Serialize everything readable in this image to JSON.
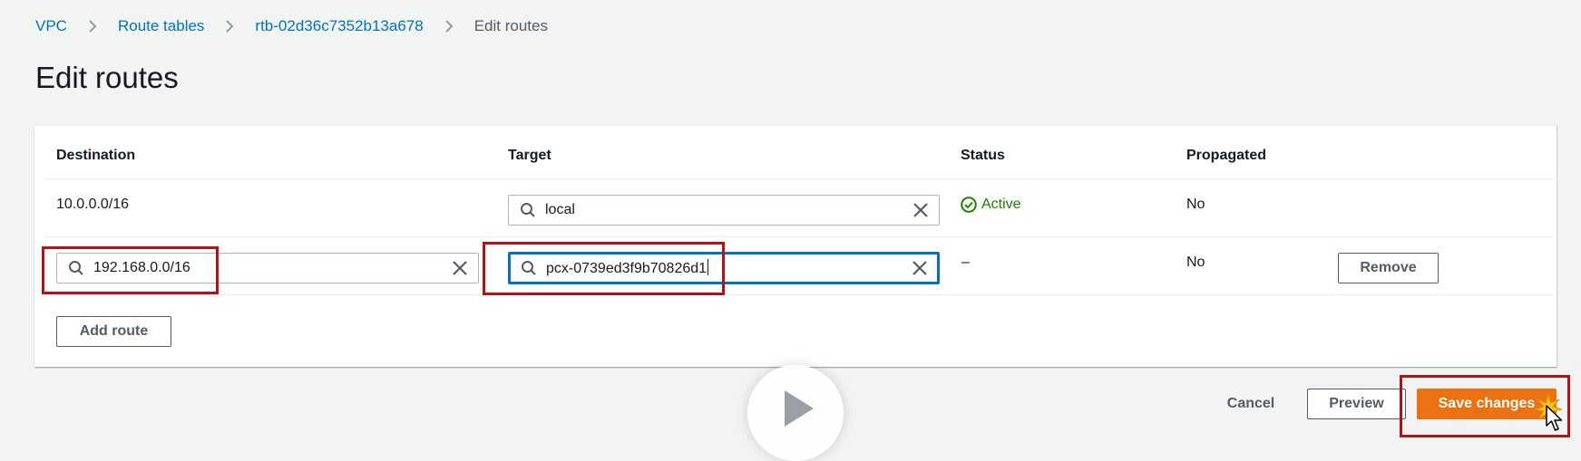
{
  "breadcrumb": {
    "items": [
      "VPC",
      "Route tables",
      "rtb-02d36c7352b13a678"
    ],
    "current": "Edit routes"
  },
  "page": {
    "title": "Edit routes"
  },
  "table": {
    "columns": {
      "destination": "Destination",
      "target": "Target",
      "status": "Status",
      "propagated": "Propagated"
    },
    "rows": [
      {
        "destination": "10.0.0.0/16",
        "target": "local",
        "status": "Active",
        "propagated": "No"
      },
      {
        "destination": "192.168.0.0/16",
        "target": "pcx-0739ed3f9b70826d1",
        "status": "–",
        "propagated": "No",
        "remove_label": "Remove"
      }
    ],
    "add_route_label": "Add route"
  },
  "footer": {
    "cancel_label": "Cancel",
    "preview_label": "Preview",
    "save_label": "Save changes"
  },
  "colors": {
    "link": "#0073bb",
    "primary": "#ec7211",
    "success": "#1d8102",
    "highlight": "#b01217",
    "focus": "#0073bb"
  },
  "icons": {
    "breadcrumb_separator": "chevron-right-icon",
    "search": "search-icon",
    "clear": "close-icon",
    "status_ok": "check-circle-icon",
    "play": "play-icon",
    "cursor": "mouse-pointer-icon"
  }
}
